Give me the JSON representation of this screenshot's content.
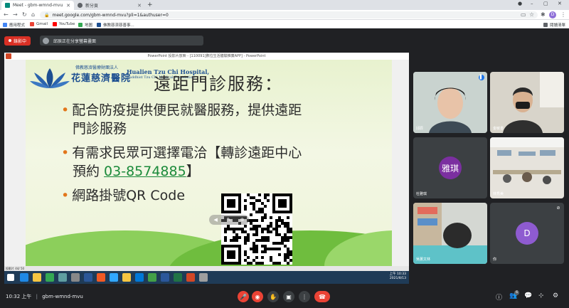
{
  "browser": {
    "tabs": [
      {
        "label": "Meet - gbm-wmnd-mvu",
        "active": true
      },
      {
        "label": "新分頁",
        "active": false
      }
    ],
    "url": "meet.google.com/gbm-wmnd-mvu?pli=1&authuser=0",
    "profile_initial": "D",
    "bookmarks": [
      "應用程式",
      "Gmail",
      "YouTube",
      "地圖",
      "佛教慈濟慈善事...",
      "閱讀清單"
    ]
  },
  "meet": {
    "record_label": "錄影中",
    "presenter_label": "邱辰正在分享螢幕畫面",
    "meeting_code": "gbm-wmnd-mvu",
    "time": "10:32 上午"
  },
  "share": {
    "window_title": "PowerPoint 投影片放映 - [110091]數位生活體驗推廣APP] - PowerPoint",
    "status_text": "投影片 44/ 50",
    "slide": {
      "logo_line1": "佛教慈濟醫療財團法人",
      "logo_line2": "花蓮慈濟醫院",
      "logo_en1": "Hualien Tzu Chi Hospital,",
      "logo_en2": "Buddhist Tzu Chi Medical Foundation",
      "title": "遠距門診服務：",
      "bullet1_a": "配合防疫提供便民就醫服務，提供遠距",
      "bullet1_b": "門診服務",
      "bullet2_a": "有需求民眾可選擇電洽【轉診遠距中心",
      "bullet2_b_pre": "預約 ",
      "bullet2_b_phone": "03-8574885",
      "bullet2_b_post": "】",
      "bullet3": "網路掛號QR Code"
    },
    "taskbar_clock_time": "上午 10:33",
    "taskbar_clock_date": "2021/8/13"
  },
  "participants": [
    {
      "name": "邱辰"
    },
    {
      "name": "金敏書"
    },
    {
      "name": "杜雅琪",
      "initials": "雅琪"
    },
    {
      "name": "林秀美"
    },
    {
      "name": "吳蕙文林"
    },
    {
      "name": "你",
      "initials": "D"
    }
  ],
  "colors": {
    "accent_red": "#ea4335",
    "avatar_purple": "#7b2fa0",
    "avatar_self": "#8e5bd0"
  }
}
